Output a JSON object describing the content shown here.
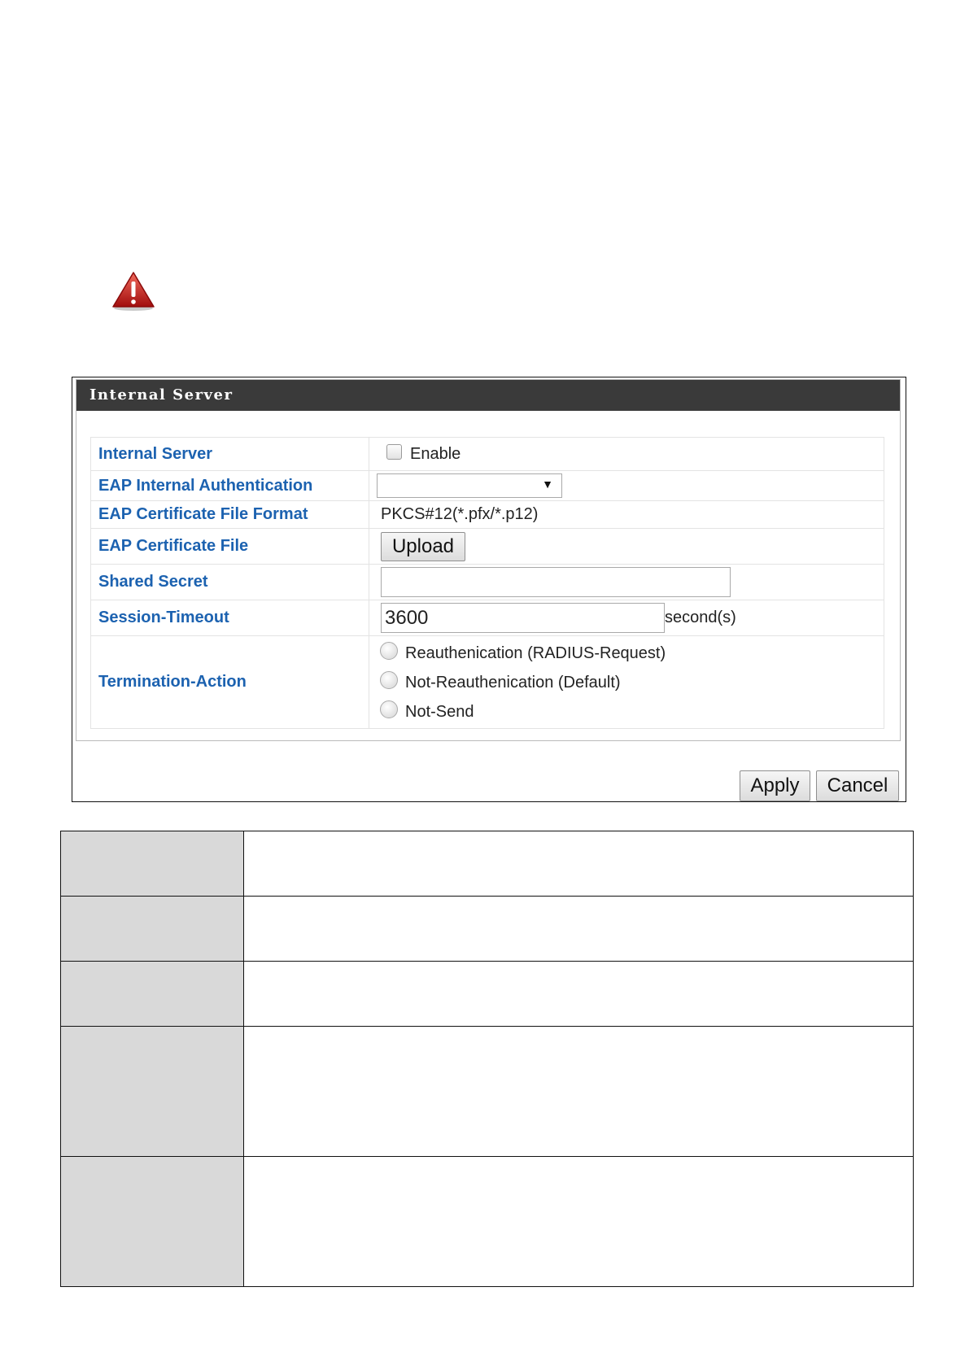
{
  "warning_icon": "warning-triangle-icon",
  "panel": {
    "title": "Internal Server",
    "rows": {
      "internal_server": {
        "label": "Internal Server",
        "checkbox_label": "Enable",
        "checked": false
      },
      "eap_auth": {
        "label": "EAP Internal Authentication",
        "selected": ""
      },
      "cert_format": {
        "label": "EAP Certificate File Format",
        "value": "PKCS#12(*.pfx/*.p12)"
      },
      "cert_file": {
        "label": "EAP Certificate File",
        "button": "Upload"
      },
      "shared_secret": {
        "label": "Shared Secret",
        "value": ""
      },
      "session_timeout": {
        "label": "Session-Timeout",
        "value": "3600",
        "unit": "second(s)"
      },
      "termination_action": {
        "label": "Termination-Action",
        "options": [
          "Reauthenication (RADIUS-Request)",
          "Not-Reauthenication (Default)",
          "Not-Send"
        ]
      }
    },
    "apply": "Apply",
    "cancel": "Cancel"
  },
  "description_table": {
    "header_color": "#d9d9d9",
    "rows": 5
  }
}
